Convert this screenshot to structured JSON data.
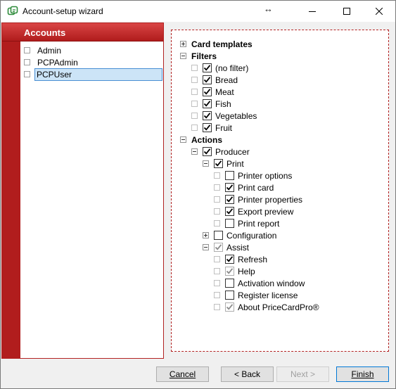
{
  "window": {
    "title": "Account-setup wizard"
  },
  "accounts": {
    "header": "Accounts",
    "items": [
      {
        "label": "Admin",
        "selected": false
      },
      {
        "label": "PCPAdmin",
        "selected": false
      },
      {
        "label": "PCPUser",
        "selected": true
      }
    ]
  },
  "tree": [
    {
      "label": "Card templates",
      "level": 0,
      "expander": "plus",
      "checkbox": null,
      "bold": true
    },
    {
      "label": "Filters",
      "level": 0,
      "expander": "minus",
      "checkbox": null,
      "bold": true
    },
    {
      "label": "(no filter)",
      "level": 1,
      "expander": "leaf",
      "checkbox": "checked",
      "bold": false
    },
    {
      "label": "Bread",
      "level": 1,
      "expander": "leaf",
      "checkbox": "checked",
      "bold": false
    },
    {
      "label": "Meat",
      "level": 1,
      "expander": "leaf",
      "checkbox": "checked",
      "bold": false
    },
    {
      "label": "Fish",
      "level": 1,
      "expander": "leaf",
      "checkbox": "checked",
      "bold": false
    },
    {
      "label": "Vegetables",
      "level": 1,
      "expander": "leaf",
      "checkbox": "checked",
      "bold": false
    },
    {
      "label": "Fruit",
      "level": 1,
      "expander": "leaf",
      "checkbox": "checked",
      "bold": false
    },
    {
      "label": "Actions",
      "level": 0,
      "expander": "minus",
      "checkbox": null,
      "bold": true
    },
    {
      "label": "Producer",
      "level": 1,
      "expander": "minus",
      "checkbox": "checked",
      "bold": false
    },
    {
      "label": "Print",
      "level": 2,
      "expander": "minus",
      "checkbox": "checked",
      "bold": false
    },
    {
      "label": "Printer options",
      "level": 3,
      "expander": "leaf",
      "checkbox": "unchecked",
      "bold": false
    },
    {
      "label": "Print card",
      "level": 3,
      "expander": "leaf",
      "checkbox": "checked",
      "bold": false
    },
    {
      "label": "Printer properties",
      "level": 3,
      "expander": "leaf",
      "checkbox": "checked",
      "bold": false
    },
    {
      "label": "Export preview",
      "level": 3,
      "expander": "leaf",
      "checkbox": "checked",
      "bold": false
    },
    {
      "label": "Print report",
      "level": 3,
      "expander": "leaf",
      "checkbox": "unchecked",
      "bold": false
    },
    {
      "label": "Configuration",
      "level": 2,
      "expander": "plus",
      "checkbox": "unchecked",
      "bold": false
    },
    {
      "label": "Assist",
      "level": 2,
      "expander": "minus",
      "checkbox": "gray-checked",
      "bold": false
    },
    {
      "label": "Refresh",
      "level": 3,
      "expander": "leaf",
      "checkbox": "checked",
      "bold": false
    },
    {
      "label": "Help",
      "level": 3,
      "expander": "leaf",
      "checkbox": "gray-checked",
      "bold": false
    },
    {
      "label": "Activation window",
      "level": 3,
      "expander": "leaf",
      "checkbox": "unchecked",
      "bold": false
    },
    {
      "label": "Register license",
      "level": 3,
      "expander": "leaf",
      "checkbox": "unchecked",
      "bold": false
    },
    {
      "label": "About PriceCardPro®",
      "level": 3,
      "expander": "leaf",
      "checkbox": "gray-checked",
      "bold": false
    }
  ],
  "buttons": {
    "cancel": {
      "label": "Cancel",
      "enabled": true
    },
    "back": {
      "label": "< Back",
      "enabled": true
    },
    "next": {
      "label": "Next >",
      "enabled": false
    },
    "finish": {
      "label": "Finish",
      "enabled": true
    }
  },
  "colors": {
    "accent_red": "#b11d1d",
    "selection": "#cce4f7",
    "selection_border": "#4a8fd4"
  }
}
